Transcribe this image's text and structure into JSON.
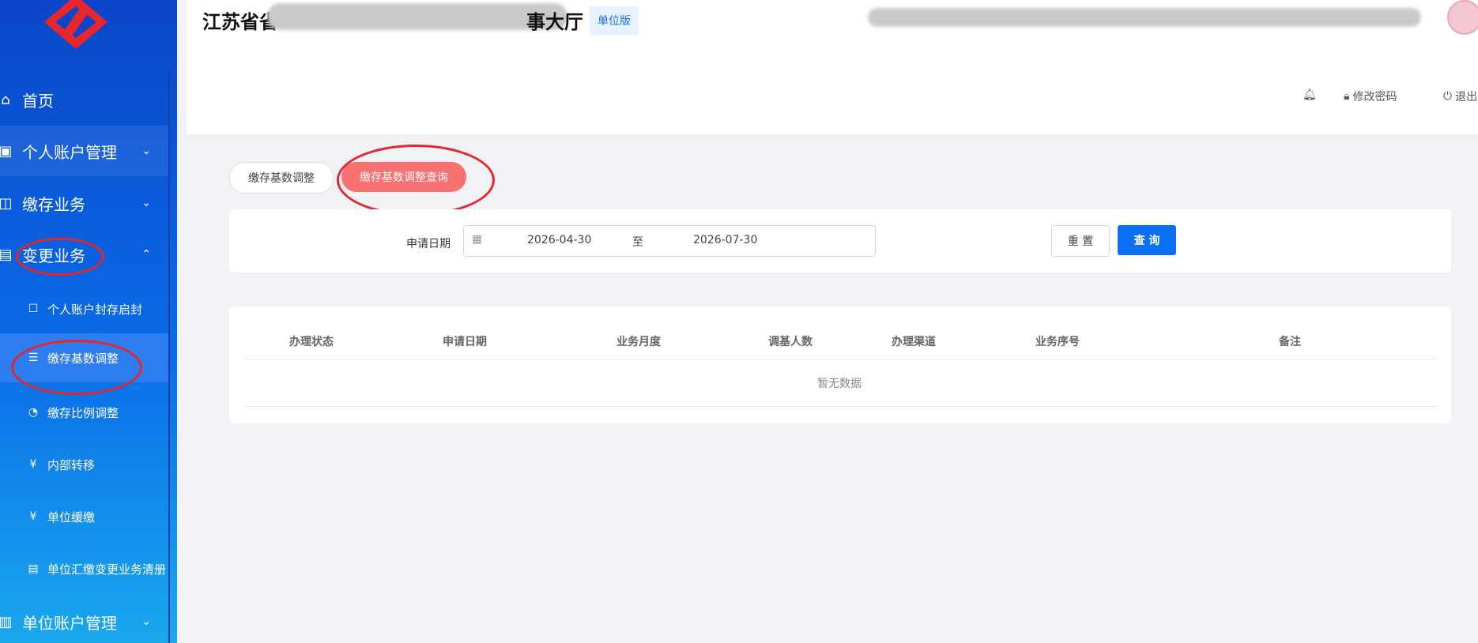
{
  "sidebar": {
    "items": [
      {
        "label": "首页",
        "icon": "home-icon"
      },
      {
        "label": "个人账户管理",
        "icon": "id-card-icon"
      },
      {
        "label": "缴存业务",
        "icon": "chart-icon"
      },
      {
        "label": "变更业务",
        "icon": "clipboard-icon"
      },
      {
        "label": "单位账户管理",
        "icon": "building-icon"
      }
    ],
    "sub_items": [
      {
        "label": "个人账户封存启封",
        "icon": "person-lock-icon"
      },
      {
        "label": "缴存基数调整",
        "icon": "sliders-icon"
      },
      {
        "label": "缴存比例调整",
        "icon": "pie-icon"
      },
      {
        "label": "内部转移",
        "icon": "yen-cycle-icon"
      },
      {
        "label": "单位缓缴",
        "icon": "yen-cycle-icon"
      },
      {
        "label": "单位汇缴变更业务清册",
        "icon": "clipboard-icon"
      }
    ],
    "chevron_down": "⌄",
    "chevron_up": "⌃"
  },
  "header": {
    "title_left": "江苏省省",
    "title_right": "事大厅",
    "badge": "单位版",
    "change_password": "修改密码",
    "logout": "退出"
  },
  "tabs": [
    "缴存基数调整",
    "缴存基数调整查询"
  ],
  "search": {
    "label": "申请日期",
    "start_date": "2026-04-30",
    "separator": "至",
    "end_date": "2026-07-30",
    "reset": "重 置",
    "query": "查 询"
  },
  "table": {
    "columns": [
      "办理状态",
      "申请日期",
      "业务月度",
      "调基人数",
      "办理渠道",
      "业务序号",
      "备注"
    ],
    "empty_text": "暂无数据"
  },
  "colors": {
    "annotation": "#e3262b",
    "primary": "#0a6ff0",
    "active_tab": "#f87171"
  }
}
